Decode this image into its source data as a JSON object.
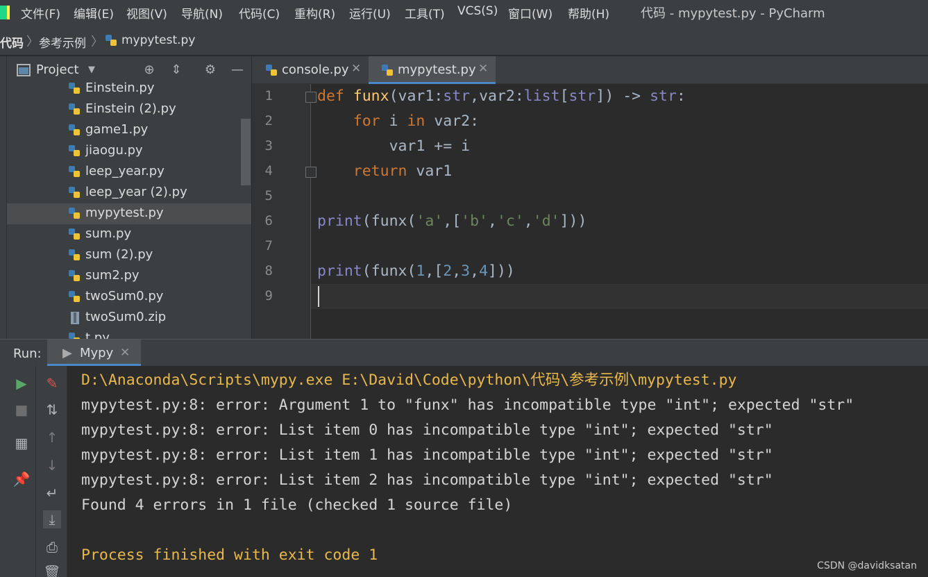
{
  "menubar": {
    "items": [
      "文件(F)",
      "编辑(E)",
      "视图(V)",
      "导航(N)",
      "代码(C)",
      "重构(R)",
      "运行(U)",
      "工具(T)",
      "VCS(S)",
      "窗口(W)",
      "帮助(H)"
    ],
    "window_title": "代码 - mypytest.py - PyCharm"
  },
  "breadcrumb": {
    "items": [
      "代码",
      "参考示例",
      "mypytest.py"
    ]
  },
  "project_panel": {
    "title": "Project",
    "files": [
      {
        "name": "Einstein.py",
        "icon": "python-file-icon"
      },
      {
        "name": "Einstein (2).py",
        "icon": "python-file-icon"
      },
      {
        "name": "game1.py",
        "icon": "python-file-icon"
      },
      {
        "name": "jiaogu.py",
        "icon": "python-file-icon"
      },
      {
        "name": "leep_year.py",
        "icon": "python-file-icon"
      },
      {
        "name": "leep_year (2).py",
        "icon": "python-file-icon"
      },
      {
        "name": "mypytest.py",
        "icon": "python-file-icon",
        "selected": true
      },
      {
        "name": "sum.py",
        "icon": "python-file-icon"
      },
      {
        "name": "sum (2).py",
        "icon": "python-file-icon"
      },
      {
        "name": "sum2.py",
        "icon": "python-file-icon"
      },
      {
        "name": "twoSum0.py",
        "icon": "python-file-icon"
      },
      {
        "name": "twoSum0.zip",
        "icon": "zip-file-icon"
      },
      {
        "name": "t.py",
        "icon": "python-file-icon"
      }
    ]
  },
  "editor": {
    "tabs": [
      {
        "label": "console.py",
        "active": false
      },
      {
        "label": "mypytest.py",
        "active": true
      }
    ],
    "line_numbers": [
      "1",
      "2",
      "3",
      "4",
      "5",
      "6",
      "7",
      "8",
      "9"
    ],
    "lines": [
      "def funx(var1:str,var2:list[str]) -> str:",
      "    for i in var2:",
      "        var1 += i",
      "    return var1",
      "",
      "print(funx('a',['b','c','d']))",
      "",
      "print(funx(1,[2,3,4]))",
      ""
    ]
  },
  "run_panel": {
    "label": "Run:",
    "tab_label": "Mypy",
    "output": [
      "D:\\Anaconda\\Scripts\\mypy.exe E:\\David\\Code\\python\\代码\\参考示例\\mypytest.py",
      "mypytest.py:8: error: Argument 1 to \"funx\" has incompatible type \"int\"; expected \"str\"",
      "mypytest.py:8: error: List item 0 has incompatible type \"int\"; expected \"str\"",
      "mypytest.py:8: error: List item 1 has incompatible type \"int\"; expected \"str\"",
      "mypytest.py:8: error: List item 2 has incompatible type \"int\"; expected \"str\"",
      "Found 4 errors in 1 file (checked 1 source file)",
      "",
      "Process finished with exit code 1"
    ]
  },
  "watermark": "CSDN @davidksatan",
  "colors": {
    "background": "#2b2b2b",
    "panel": "#3c3f41",
    "keyword": "#cc7832",
    "function": "#ffc66d",
    "builtin": "#8888c6",
    "string": "#6a8759",
    "number": "#6897bb",
    "command": "#e8b84a"
  }
}
